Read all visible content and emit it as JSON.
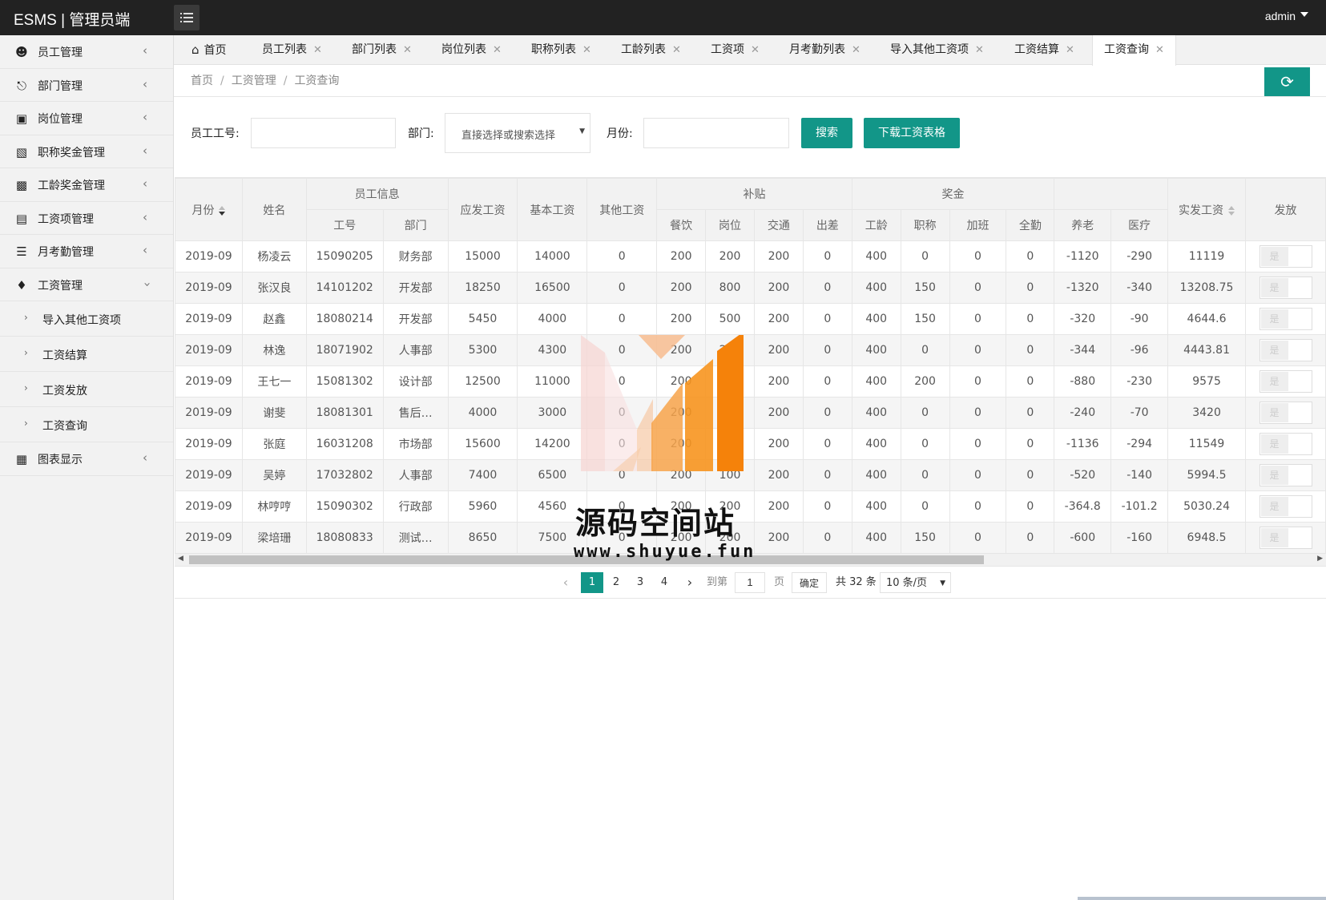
{
  "app": {
    "title": "ESMS | 管理员端",
    "user": "admin"
  },
  "sidebar": {
    "items": [
      {
        "label": "员工管理",
        "icon": "users-icon"
      },
      {
        "label": "部门管理",
        "icon": "sitemap-icon"
      },
      {
        "label": "岗位管理",
        "icon": "id-badge-icon"
      },
      {
        "label": "职称奖金管理",
        "icon": "briefcase-icon"
      },
      {
        "label": "工龄奖金管理",
        "icon": "building-icon"
      },
      {
        "label": "工资项管理",
        "icon": "list-alt-icon"
      },
      {
        "label": "月考勤管理",
        "icon": "layers-icon"
      },
      {
        "label": "工资管理",
        "icon": "tags-icon"
      }
    ],
    "sub_items": [
      {
        "label": "导入其他工资项"
      },
      {
        "label": "工资结算"
      },
      {
        "label": "工资发放"
      },
      {
        "label": "工资查询"
      }
    ],
    "last_item": {
      "label": "图表显示",
      "icon": "receipt-icon"
    }
  },
  "tabs": [
    {
      "label": "首页",
      "icon": "home-icon"
    },
    {
      "label": "员工列表"
    },
    {
      "label": "部门列表"
    },
    {
      "label": "岗位列表"
    },
    {
      "label": "职称列表"
    },
    {
      "label": "工龄列表"
    },
    {
      "label": "工资项"
    },
    {
      "label": "月考勤列表"
    },
    {
      "label": "导入其他工资项"
    },
    {
      "label": "工资结算"
    },
    {
      "label": "工资查询",
      "active": true
    }
  ],
  "breadcrumb": [
    "首页",
    "工资管理",
    "工资查询"
  ],
  "filters": {
    "emp_no_label": "员工工号:",
    "dept_label": "部门:",
    "dept_placeholder": "直接选择或搜索选择",
    "month_label": "月份:",
    "search_btn": "搜索",
    "download_btn": "下载工资表格"
  },
  "table": {
    "group_headers": {
      "emp_info": "员工信息",
      "subsidy": "补贴",
      "bonus": "奖金"
    },
    "headers": {
      "month": "月份",
      "name": "姓名",
      "emp_no": "工号",
      "dept": "部门",
      "gross": "应发工资",
      "base": "基本工资",
      "other": "其他工资",
      "meal": "餐饮",
      "post": "岗位",
      "transport": "交通",
      "travel": "出差",
      "seniority": "工龄",
      "title": "职称",
      "overtime": "加班",
      "attendance": "全勤",
      "pension": "养老",
      "medical": "医疗",
      "net": "实发工资",
      "issue": "发放"
    },
    "switch_label": "是",
    "rows": [
      [
        "2019-09",
        "杨凌云",
        "15090205",
        "财务部",
        "15000",
        "14000",
        "0",
        "200",
        "200",
        "200",
        "0",
        "400",
        "0",
        "0",
        "0",
        "-1120",
        "-290",
        "11119"
      ],
      [
        "2019-09",
        "张汉良",
        "14101202",
        "开发部",
        "18250",
        "16500",
        "0",
        "200",
        "800",
        "200",
        "0",
        "400",
        "150",
        "0",
        "0",
        "-1320",
        "-340",
        "13208.75"
      ],
      [
        "2019-09",
        "赵鑫",
        "18080214",
        "开发部",
        "5450",
        "4000",
        "0",
        "200",
        "500",
        "200",
        "0",
        "400",
        "150",
        "0",
        "0",
        "-320",
        "-90",
        "4644.6"
      ],
      [
        "2019-09",
        "林逸",
        "18071902",
        "人事部",
        "5300",
        "4300",
        "0",
        "200",
        "200",
        "200",
        "0",
        "400",
        "0",
        "0",
        "0",
        "-344",
        "-96",
        "4443.81"
      ],
      [
        "2019-09",
        "王七一",
        "15081302",
        "设计部",
        "12500",
        "11000",
        "0",
        "200",
        "200",
        "200",
        "0",
        "400",
        "200",
        "0",
        "0",
        "-880",
        "-230",
        "9575"
      ],
      [
        "2019-09",
        "谢斐",
        "18081301",
        "售后…",
        "4000",
        "3000",
        "0",
        "200",
        "200",
        "200",
        "0",
        "400",
        "0",
        "0",
        "0",
        "-240",
        "-70",
        "3420"
      ],
      [
        "2019-09",
        "张庭",
        "16031208",
        "市场部",
        "15600",
        "14200",
        "0",
        "200",
        "200",
        "200",
        "0",
        "400",
        "0",
        "0",
        "0",
        "-1136",
        "-294",
        "11549"
      ],
      [
        "2019-09",
        "吴婷",
        "17032802",
        "人事部",
        "7400",
        "6500",
        "0",
        "200",
        "100",
        "200",
        "0",
        "400",
        "0",
        "0",
        "0",
        "-520",
        "-140",
        "5994.5"
      ],
      [
        "2019-09",
        "林哼哼",
        "15090302",
        "行政部",
        "5960",
        "4560",
        "0",
        "200",
        "200",
        "200",
        "0",
        "400",
        "0",
        "0",
        "0",
        "-364.8",
        "-101.2",
        "5030.24"
      ],
      [
        "2019-09",
        "梁培珊",
        "18080833",
        "测试…",
        "8650",
        "7500",
        "0",
        "200",
        "200",
        "200",
        "0",
        "400",
        "150",
        "0",
        "0",
        "-600",
        "-160",
        "6948.5"
      ]
    ]
  },
  "pagination": {
    "pages": [
      "1",
      "2",
      "3",
      "4"
    ],
    "current": "1",
    "goto_label": "到第",
    "goto_value": "1",
    "page_unit": "页",
    "confirm": "确定",
    "total": "共 32 条",
    "page_size": "10 条/页"
  },
  "watermark": {
    "title": "源码空间站",
    "url": "www.shuyue.fun"
  },
  "colors": {
    "accent": "#129688",
    "topbar": "#222222",
    "watermark_orange": "#f5820a"
  }
}
